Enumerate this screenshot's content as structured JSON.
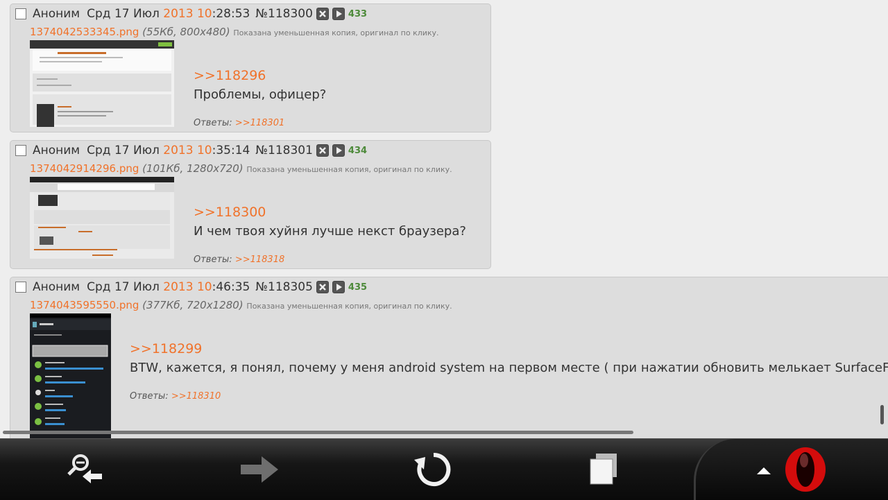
{
  "posts": [
    {
      "name": "Аноним",
      "date_prefix": "Срд 17 Июл",
      "year": "2013",
      "hour": "10",
      "time_rest": ":28:53",
      "post_number": "№118300",
      "counter": "433",
      "file_name": "1374042533345.png",
      "file_meta": "55Кб, 800x480",
      "file_note": "Показана уменьшенная копия, оригинал по клику.",
      "reply_to": ">>118296",
      "message": "Проблемы, офицер?",
      "answers_label": "Ответы:",
      "answers_link": ">>118301"
    },
    {
      "name": "Аноним",
      "date_prefix": "Срд 17 Июл",
      "year": "2013",
      "hour": "10",
      "time_rest": ":35:14",
      "post_number": "№118301",
      "counter": "434",
      "file_name": "1374042914296.png",
      "file_meta": "101Кб, 1280x720",
      "file_note": "Показана уменьшенная копия, оригинал по клику.",
      "reply_to": ">>118300",
      "message": "И чем твоя хуйня лучше некст браузера?",
      "answers_label": "Ответы:",
      "answers_link": ">>118318"
    },
    {
      "name": "Аноним",
      "date_prefix": "Срд 17 Июл",
      "year": "2013",
      "hour": "10",
      "time_rest": ":46:35",
      "post_number": "№118305",
      "counter": "435",
      "file_name": "1374043595550.png",
      "file_meta": "377Кб, 720x1280",
      "file_note": "Показана уменьшенная копия, оригинал по клику.",
      "reply_to": ">>118299",
      "message": "BTW, кажется, я понял, почему у меня android system на первом месте ( при нажатии обновить мелькает SurfaceFlinger). Это",
      "answers_label": "Ответы:",
      "answers_link": ">>118310"
    }
  ],
  "toolbar": {
    "icons": [
      "zoom-back-icon",
      "forward-arrow-icon",
      "reload-icon",
      "tabs-icon",
      "opera-menu-icon"
    ],
    "colors": {
      "accent": "#f0722a",
      "counter": "#4d8a3a",
      "opera_red": "#d40c0c"
    }
  }
}
